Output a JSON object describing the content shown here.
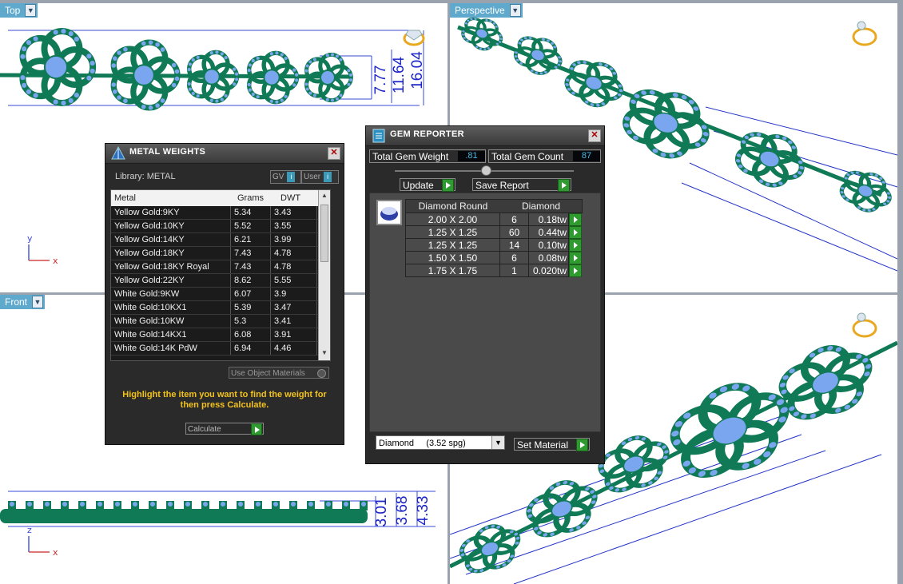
{
  "viewports": {
    "top": {
      "label": "Top",
      "dims": [
        "7.77",
        "11.64",
        "16.04"
      ],
      "axis_x": "x",
      "axis_y": "y"
    },
    "perspective": {
      "label": "Perspective"
    },
    "front": {
      "label": "Front",
      "dims": [
        "3.01",
        "3.68",
        "4.33"
      ],
      "axis_x": "x",
      "axis_y": "z"
    }
  },
  "metal_weights": {
    "title": "METAL WEIGHTS",
    "library_label": "Library: METAL",
    "gv_label": "GV",
    "user_label": "User",
    "columns": [
      "Metal",
      "Grams",
      "DWT"
    ],
    "rows": [
      [
        "Yellow Gold:9KY",
        "5.34",
        "3.43"
      ],
      [
        "Yellow Gold:10KY",
        "5.52",
        "3.55"
      ],
      [
        "Yellow Gold:14KY",
        "6.21",
        "3.99"
      ],
      [
        "Yellow Gold:18KY",
        "7.43",
        "4.78"
      ],
      [
        "Yellow Gold:18KY Royal",
        "7.43",
        "4.78"
      ],
      [
        "Yellow Gold:22KY",
        "8.62",
        "5.55"
      ],
      [
        "White Gold:9KW",
        "6.07",
        "3.9"
      ],
      [
        "White Gold:10KX1",
        "5.39",
        "3.47"
      ],
      [
        "White Gold:10KW",
        "5.3",
        "3.41"
      ],
      [
        "White Gold:14KX1",
        "6.08",
        "3.91"
      ],
      [
        "White Gold:14K PdW",
        "6.94",
        "4.46"
      ]
    ],
    "use_object_materials": "Use Object Materials",
    "hint": "Highlight the item you want to find the weight for then press Calculate.",
    "calculate_label": "Calculate"
  },
  "gem_reporter": {
    "title": "GEM REPORTER",
    "total_weight_label": "Total Gem Weight",
    "total_weight_value": ".81",
    "total_count_label": "Total Gem Count",
    "total_count_value": "87",
    "update_label": "Update",
    "save_report_label": "Save Report",
    "columns": [
      "Diamond Round",
      "Diamond"
    ],
    "rows": [
      [
        "2.00 X 2.00",
        "6",
        "0.18tw"
      ],
      [
        "1.25 X 1.25",
        "60",
        "0.44tw"
      ],
      [
        "1.25 X 1.25",
        "14",
        "0.10tw"
      ],
      [
        "1.50 X 1.50",
        "6",
        "0.08tw"
      ],
      [
        "1.75 X 1.75",
        "1",
        "0.020tw"
      ]
    ],
    "material_select": "Diamond     (3.52 spg)",
    "set_material_label": "Set Material"
  },
  "colors": {
    "metal_green": "#0f7a55",
    "gem_blue": "#7aa6f0",
    "dimension_blue": "#1a24c8",
    "tab_blue": "#5fa9cc",
    "hint_yellow": "#f2c21b"
  }
}
